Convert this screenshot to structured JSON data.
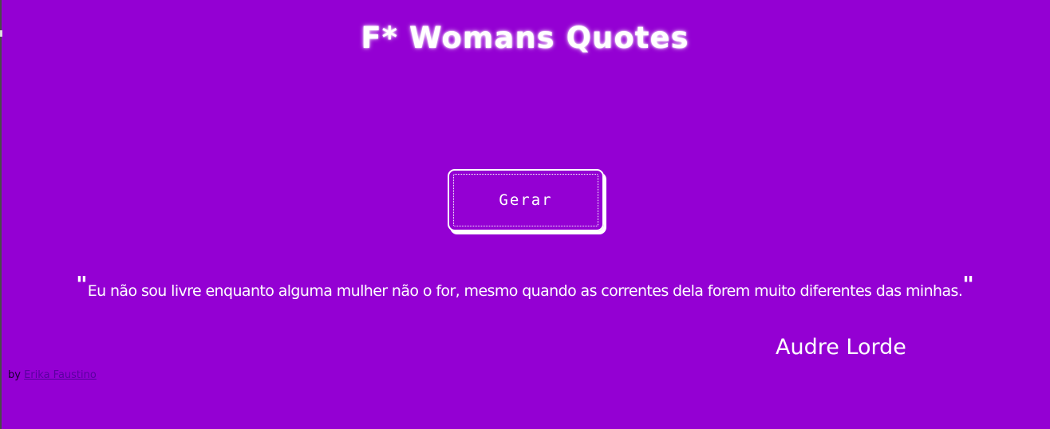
{
  "header": {
    "title": "F* Womans Quotes"
  },
  "actions": {
    "generate_label": "Gerar"
  },
  "quote": {
    "open_mark": "\"",
    "text": "Eu não sou livre enquanto alguma mulher não o for, mesmo quando as correntes dela forem muito diferentes das minhas.",
    "close_mark": "\"",
    "author": "Audre Lorde"
  },
  "footer": {
    "by_label": "by",
    "author_link": "Erika Faustino"
  },
  "colors": {
    "background": "#9400d3",
    "text": "#ffffff",
    "credit_text": "#1a0030",
    "credit_link": "#5a00a0"
  }
}
